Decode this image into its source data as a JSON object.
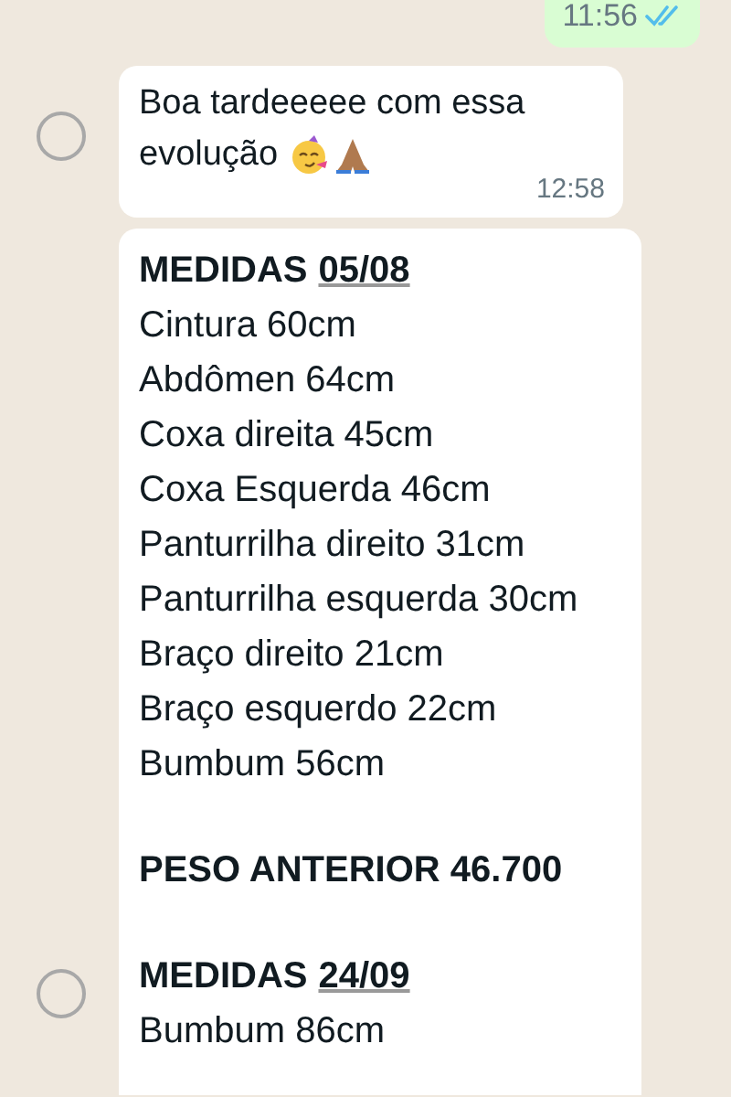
{
  "messages": [
    {
      "kind": "sent",
      "time": "11:56",
      "read": true
    },
    {
      "kind": "received",
      "lines": [
        "Boa tardeeeee com essa",
        "evolução"
      ],
      "time": "12:58",
      "selected": false
    },
    {
      "kind": "received_long",
      "selected": false,
      "lines": [
        {
          "kind": "heading",
          "text": "MEDIDAS",
          "link": "05/08"
        },
        {
          "kind": "text",
          "text": "Cintura 60cm"
        },
        {
          "kind": "text",
          "text": "Abdômen 64cm"
        },
        {
          "kind": "text",
          "text": "Coxa direita 45cm"
        },
        {
          "kind": "text",
          "text": "Coxa Esquerda 46cm"
        },
        {
          "kind": "text",
          "text": "Panturrilha direito 31cm"
        },
        {
          "kind": "text",
          "text": "Panturrilha esquerda 30cm"
        },
        {
          "kind": "text",
          "text": "Braço direito 21cm"
        },
        {
          "kind": "text",
          "text": "Braço esquerdo 22cm"
        },
        {
          "kind": "text",
          "text": "Bumbum 56cm"
        },
        {
          "kind": "bold",
          "text": "PESO ANTERIOR 46.700"
        },
        {
          "kind": "heading",
          "text": "MEDIDAS",
          "link": "24/09"
        },
        {
          "kind": "text",
          "text": "Bumbum 86cm"
        }
      ]
    }
  ]
}
